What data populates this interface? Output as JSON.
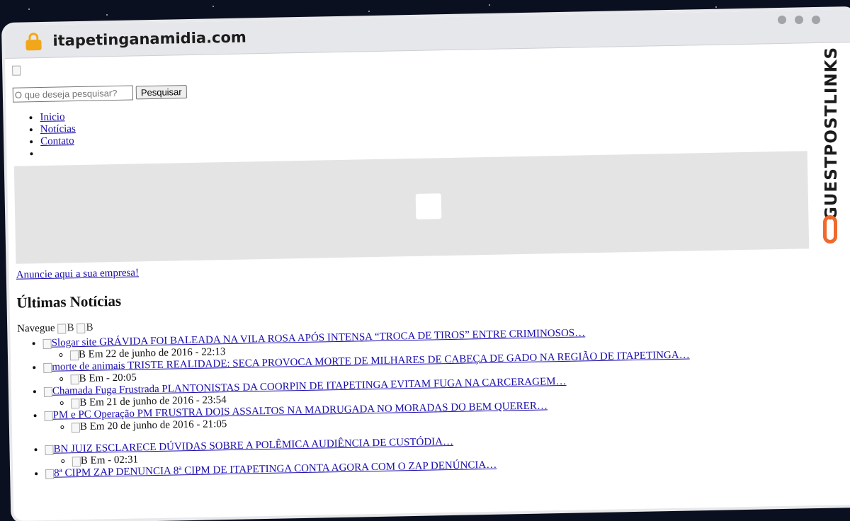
{
  "browser": {
    "url": "itapetinganamidia.com"
  },
  "watermark": {
    "text": "GUESTPOSTLINKS"
  },
  "header": {
    "logo_alt": "",
    "search": {
      "placeholder": "O que deseja pesquisar?",
      "button": "Pesquisar"
    }
  },
  "nav": {
    "items": [
      "Inicio",
      "Notícias",
      "Contato",
      ""
    ]
  },
  "ad": {
    "link": "Anuncie aqui a sua empresa!"
  },
  "news": {
    "heading": "Últimas Notícias",
    "navegue": "Navegue",
    "nav_img_alt_1": "B",
    "nav_img_alt_2": "B",
    "items": [
      {
        "img_alt": "Slogar site",
        "title": "GRÁVIDA FOI BALEADA NA VILA ROSA APÓS INTENSA “TROCA DE TIROS” ENTRE CRIMINOSOS…",
        "meta_alt": "B",
        "meta": "Em 22 de junho de 2016 - 22:13"
      },
      {
        "img_alt": "morte de animais",
        "title": "TRISTE REALIDADE: SECA PROVOCA MORTE DE MILHARES DE CABEÇA DE GADO NA REGIÃO DE ITAPETINGA…",
        "meta_alt": "B",
        "meta": "Em - 20:05"
      },
      {
        "img_alt": "Chamada Fuga Frustrada",
        "title": "PLANTONISTAS DA COORPIN DE ITAPETINGA EVITAM FUGA NA CARCERAGEM…",
        "meta_alt": "B",
        "meta": "Em 21 de junho de 2016 - 23:54"
      },
      {
        "img_alt": "PM e PC Operação",
        "title": "PM FRUSTRA DOIS ASSALTOS NA MADRUGADA NO MORADAS DO BEM QUERER…",
        "meta_alt": "B",
        "meta": "Em 20 de junho de 2016 - 21:05"
      },
      {
        "img_alt": "BN",
        "title": "JUIZ ESCLARECE DÚVIDAS SOBRE A POLÊMICA AUDIÊNCIA DE CUSTÓDIA…",
        "meta_alt": "B",
        "meta": "Em - 02:31"
      },
      {
        "img_alt": "8ª CIPM ZAP",
        "title": "DENUNCIA 8ª CIPM DE ITAPETINGA CONTA AGORA COM O ZAP DENÚNCIA…",
        "meta_alt": "",
        "meta": ""
      }
    ]
  },
  "colors": {
    "link": "#1a0dab",
    "banner": "#e4e4e4",
    "lock": "#f2a71b",
    "watermark_logo": "#f06a2c"
  }
}
